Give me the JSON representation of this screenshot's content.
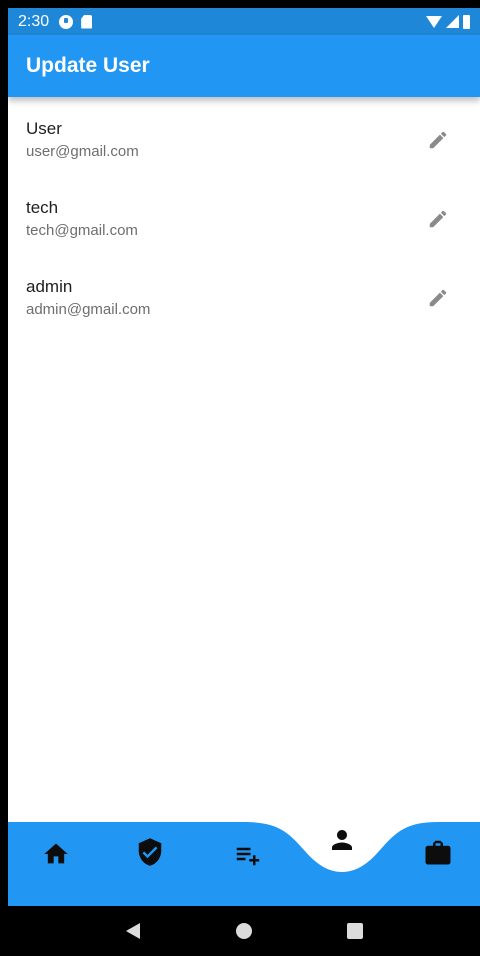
{
  "status_bar": {
    "time": "2:30"
  },
  "app_bar": {
    "title": "Update User"
  },
  "users": [
    {
      "name": "User",
      "email": "user@gmail.com"
    },
    {
      "name": "tech",
      "email": "tech@gmail.com"
    },
    {
      "name": "admin",
      "email": "admin@gmail.com"
    }
  ],
  "bottom_nav": {
    "items": [
      "home-icon",
      "shield-check-icon",
      "playlist-add-icon",
      "person-icon",
      "briefcase-icon"
    ],
    "active_item": "person-icon",
    "color": "#2196f3"
  },
  "colors": {
    "primary": "#2196f3",
    "status_bar": "#1f87d7",
    "edit_icon": "#8a8a8a"
  }
}
